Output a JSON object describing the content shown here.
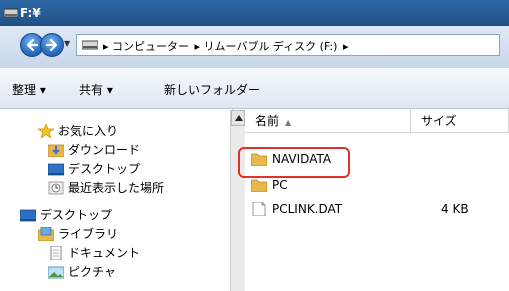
{
  "window": {
    "title": "F:¥"
  },
  "address_bar": {
    "crumbs": [
      "▸ コンピューター",
      "▸ リムーバブル ディスク (F:)",
      "▸"
    ]
  },
  "toolbar": {
    "organize": "整理 ▾",
    "share": "共有 ▾",
    "new_folder": "新しいフォルダー"
  },
  "nav": {
    "favorites": "お気に入り",
    "downloads": "ダウンロード",
    "desktop_fav": "デスクトップ",
    "recent": "最近表示した場所",
    "desktop": "デスクトップ",
    "libraries": "ライブラリ",
    "documents": "ドキュメント",
    "pictures": "ピクチャ"
  },
  "columns": {
    "name": "名前",
    "size": "サイズ"
  },
  "files": [
    {
      "name": "NAVIDATA",
      "size": ""
    },
    {
      "name": "PC",
      "size": ""
    },
    {
      "name": "PCLINK.DAT",
      "size": "4 KB"
    }
  ],
  "colors": {
    "titlebar": "#1f4f86",
    "highlight": "#e0312a",
    "folder": "#e8b84a"
  }
}
